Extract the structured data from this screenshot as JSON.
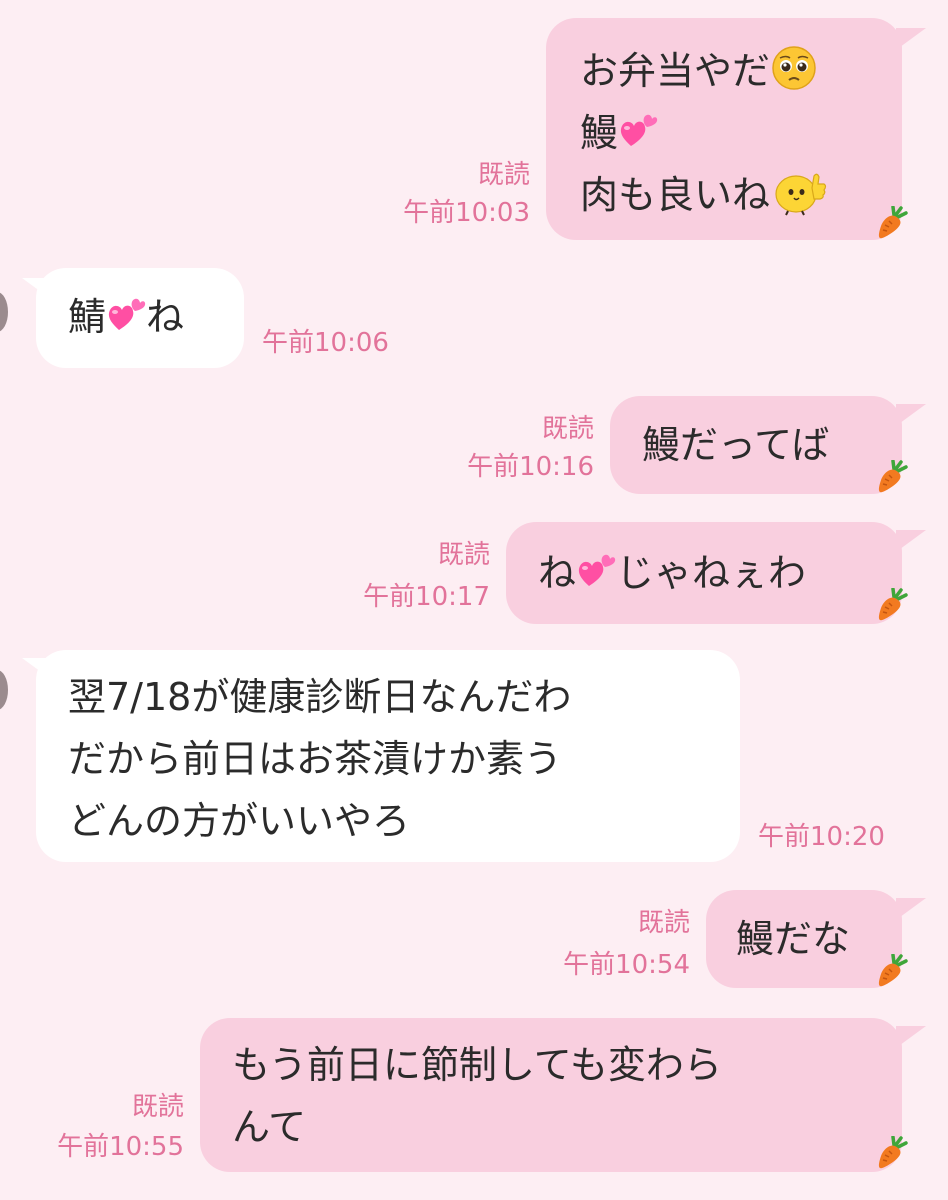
{
  "colors": {
    "background": "#fdeef3",
    "sent_bubble": "#f9cfdf",
    "received_bubble": "#ffffff",
    "meta_text": "#e2739a",
    "message_text": "#2b2b2b",
    "heart": "#ff4fa3"
  },
  "icons": {
    "heart": "two-hearts-icon",
    "pleading": "pleading-face-icon",
    "thumbs": "chick-thumbs-up-icon",
    "carrot": "carrot-icon"
  },
  "messages": [
    {
      "side": "sent",
      "lines": [
        "お弁当やだ",
        "鰻",
        "肉も良いね"
      ],
      "read": "既読",
      "time": "午前10:03"
    },
    {
      "side": "received",
      "parts": [
        "鯖",
        "ね"
      ],
      "time": "午前10:06"
    },
    {
      "side": "sent",
      "text": "鰻だってば",
      "read": "既読",
      "time": "午前10:16"
    },
    {
      "side": "sent",
      "parts": [
        "ね",
        "じゃねぇわ"
      ],
      "read": "既読",
      "time": "午前10:17"
    },
    {
      "side": "received",
      "lines": [
        "翌7/18が健康診断日なんだわ",
        "だから前日はお茶漬けか素う",
        "どんの方がいいやろ"
      ],
      "time": "午前10:20"
    },
    {
      "side": "sent",
      "text": "鰻だな",
      "read": "既読",
      "time": "午前10:54"
    },
    {
      "side": "sent",
      "lines": [
        "もう前日に節制しても変わら",
        "んて"
      ],
      "read": "既読",
      "time": "午前10:55"
    }
  ]
}
